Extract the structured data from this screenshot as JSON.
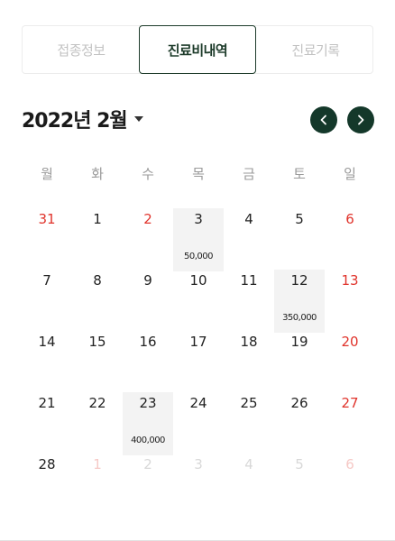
{
  "tabs": [
    {
      "label": "접종정보",
      "active": false
    },
    {
      "label": "진료비내역",
      "active": true
    },
    {
      "label": "진료기록",
      "active": false
    }
  ],
  "calendar": {
    "month_label": "2022년 2월",
    "weekdays": [
      "월",
      "화",
      "수",
      "목",
      "금",
      "토",
      "일"
    ],
    "weeks": [
      [
        {
          "day": "31",
          "type": "prev"
        },
        {
          "day": "1"
        },
        {
          "day": "2",
          "type": "prev-red"
        },
        {
          "day": "3",
          "cost": "50,000"
        },
        {
          "day": "4"
        },
        {
          "day": "5"
        },
        {
          "day": "6",
          "type": "sun"
        }
      ],
      [
        {
          "day": "7"
        },
        {
          "day": "8"
        },
        {
          "day": "9"
        },
        {
          "day": "10"
        },
        {
          "day": "11"
        },
        {
          "day": "12",
          "cost": "350,000"
        },
        {
          "day": "13",
          "type": "sun"
        }
      ],
      [
        {
          "day": "14"
        },
        {
          "day": "15"
        },
        {
          "day": "16"
        },
        {
          "day": "17"
        },
        {
          "day": "18"
        },
        {
          "day": "19"
        },
        {
          "day": "20",
          "type": "sun"
        }
      ],
      [
        {
          "day": "21"
        },
        {
          "day": "22"
        },
        {
          "day": "23",
          "cost": "400,000"
        },
        {
          "day": "24"
        },
        {
          "day": "25"
        },
        {
          "day": "26"
        },
        {
          "day": "27",
          "type": "sun"
        }
      ],
      [
        {
          "day": "28"
        },
        {
          "day": "1",
          "type": "next-red"
        },
        {
          "day": "2",
          "type": "next"
        },
        {
          "day": "3",
          "type": "next"
        },
        {
          "day": "4",
          "type": "next"
        },
        {
          "day": "5",
          "type": "next"
        },
        {
          "day": "6",
          "type": "next-red"
        }
      ]
    ]
  },
  "icons": {
    "prev": "chevron-left-icon",
    "next": "chevron-right-icon",
    "dropdown": "caret-down-icon"
  },
  "colors": {
    "accent": "#14382a",
    "sunday": "#e0332b",
    "cost_bg": "#f3f3f3"
  }
}
